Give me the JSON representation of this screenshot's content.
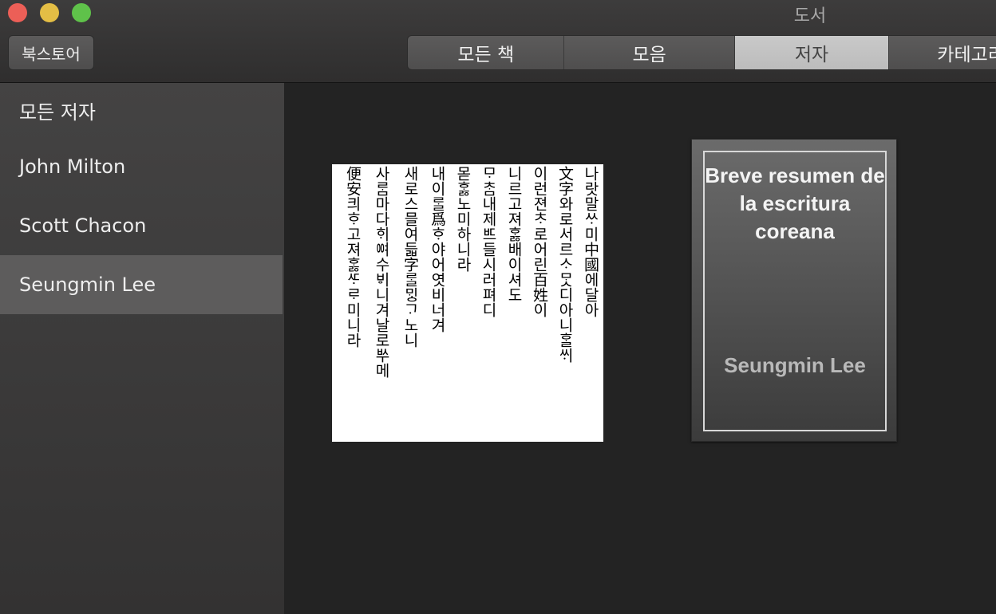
{
  "window": {
    "title": "도서"
  },
  "toolbar": {
    "store_label": "북스토어",
    "tabs": [
      {
        "label": "모든 책",
        "selected": false
      },
      {
        "label": "모음",
        "selected": false
      },
      {
        "label": "저자",
        "selected": true
      },
      {
        "label": "카테고리",
        "selected": false
      }
    ]
  },
  "sidebar": {
    "items": [
      {
        "label": "모든 저자",
        "selected": false
      },
      {
        "label": "John Milton",
        "selected": false
      },
      {
        "label": "Scott Chacon",
        "selected": false
      },
      {
        "label": "Seungmin Lee",
        "selected": true
      }
    ]
  },
  "books": [
    {
      "cover_text_columns": [
        "나랏말ᄊᆞ미中國에달아",
        "文字와로서르ᄉᆞᄆᆞᆺ디아니ᄒᆞᆯᄊᆡ",
        "이런젼ᄎᆞ로어린百姓이",
        "니르고져ᄒᆞᇙ배이셔도",
        "ᄆᆞᄎᆞᆷ내제ᄠᅳ들시러펴디",
        "몯ᄒᆞᇙ노미하니라",
        "내이ᄅᆞᆯ爲ᄒᆞ야어엿비너겨",
        "새로스믈여듧字ᄅᆞᆯᄆᆡᇰᄀᆞ노니",
        "사ᄅᆞᆷ마다ᄒᆡᅇᅧ수ᄫᅵ니겨날로ᄡᅮ메",
        "便安킈ᄒᆞ고져ᄒᆞᇙᄯᆞᄅᆞ미니라"
      ]
    },
    {
      "title": "Breve resumen de la escritura coreana",
      "author": "Seungmin Lee"
    }
  ],
  "colors": {
    "background": "#232323",
    "sidebar_selected": "#5d5c5c",
    "segment_selected": "#c9c9c9",
    "close": "#ec5f57",
    "minimize": "#e4be45",
    "maximize": "#5fc24a"
  }
}
